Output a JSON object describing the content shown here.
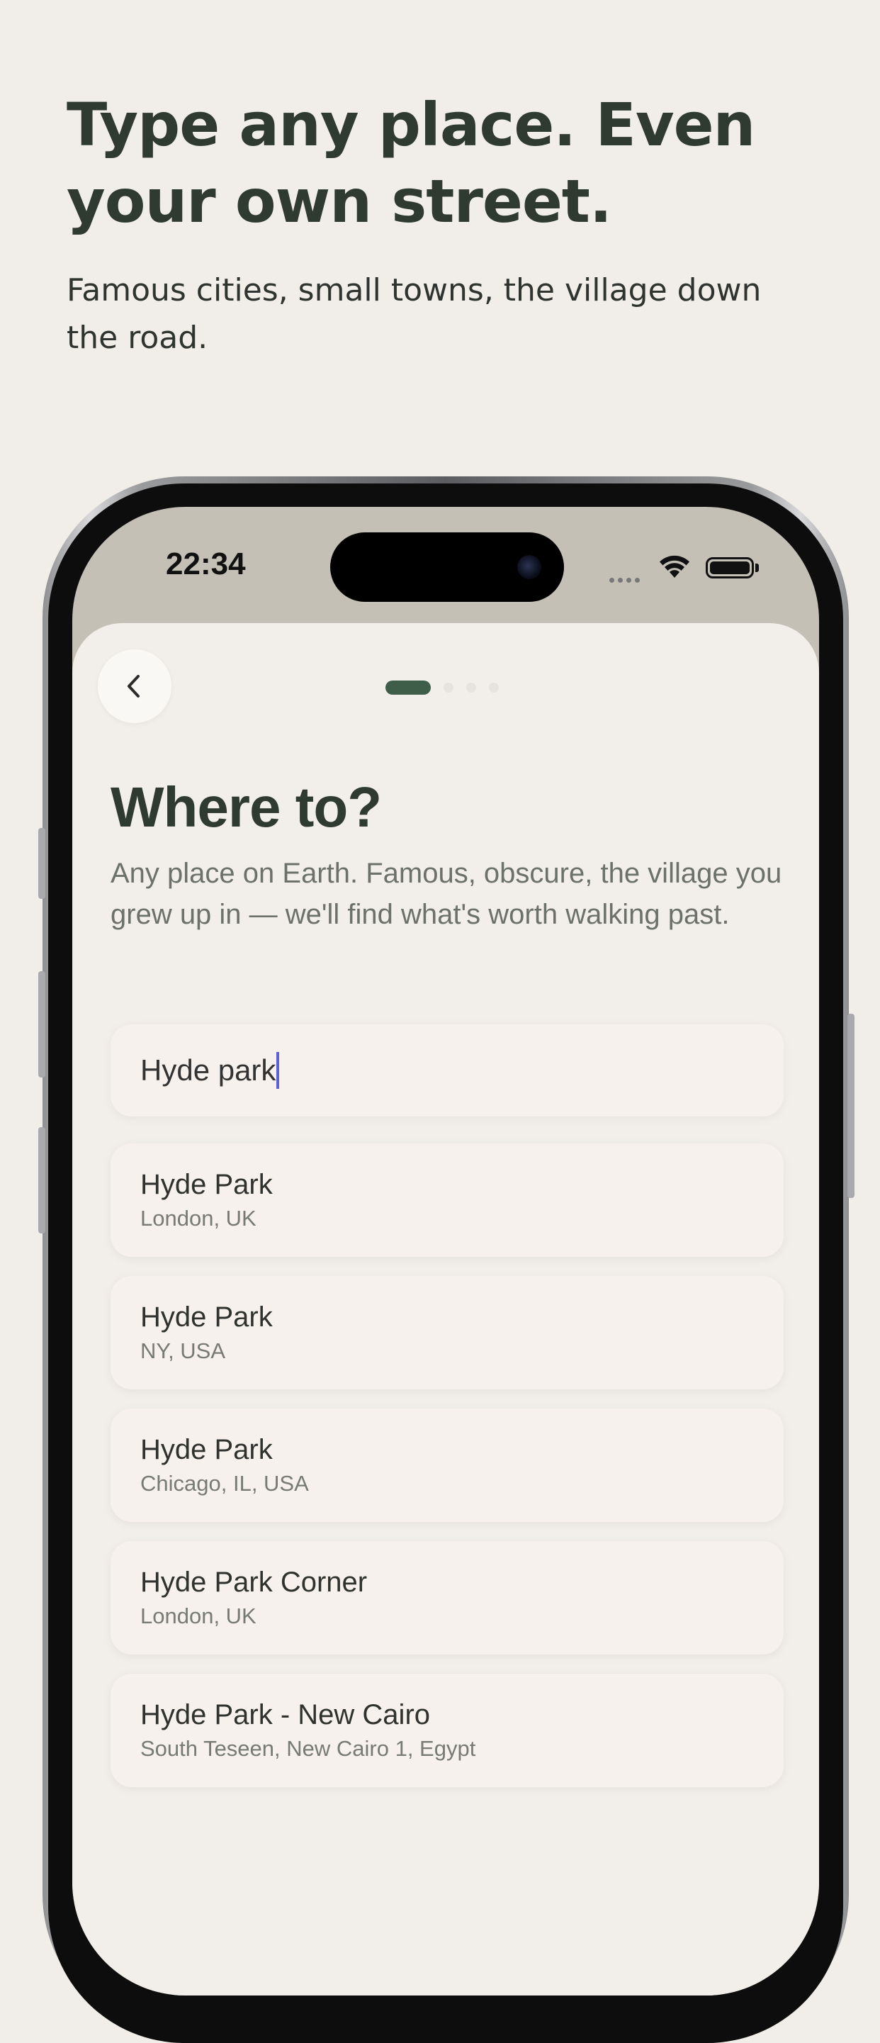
{
  "hero": {
    "title": "Type any place. Even your own street.",
    "subtitle": "Famous cities, small towns, the village down the road."
  },
  "status_bar": {
    "time": "22:34"
  },
  "screen": {
    "title": "Where to?",
    "subtitle": "Any place on Earth. Famous, obscure, the village you grew up in — we'll find what's worth walking past.",
    "pager": {
      "total": 4,
      "current": 1
    },
    "search": {
      "value": "Hyde park"
    },
    "results": [
      {
        "name": "Hyde Park",
        "location": "London, UK"
      },
      {
        "name": "Hyde Park",
        "location": "NY, USA"
      },
      {
        "name": "Hyde Park",
        "location": "Chicago, IL, USA"
      },
      {
        "name": "Hyde Park Corner",
        "location": "London, UK"
      },
      {
        "name": "Hyde Park - New Cairo",
        "location": "South Teseen, New Cairo 1, Egypt"
      }
    ]
  },
  "icons": {
    "back": "chevron-left-icon",
    "wifi": "wifi-icon",
    "battery": "battery-icon"
  },
  "colors": {
    "background": "#f1eee9",
    "heading": "#2f3b31",
    "accent": "#3f5e4a",
    "caret": "#5a64d6",
    "card": "#f6f1ec"
  }
}
